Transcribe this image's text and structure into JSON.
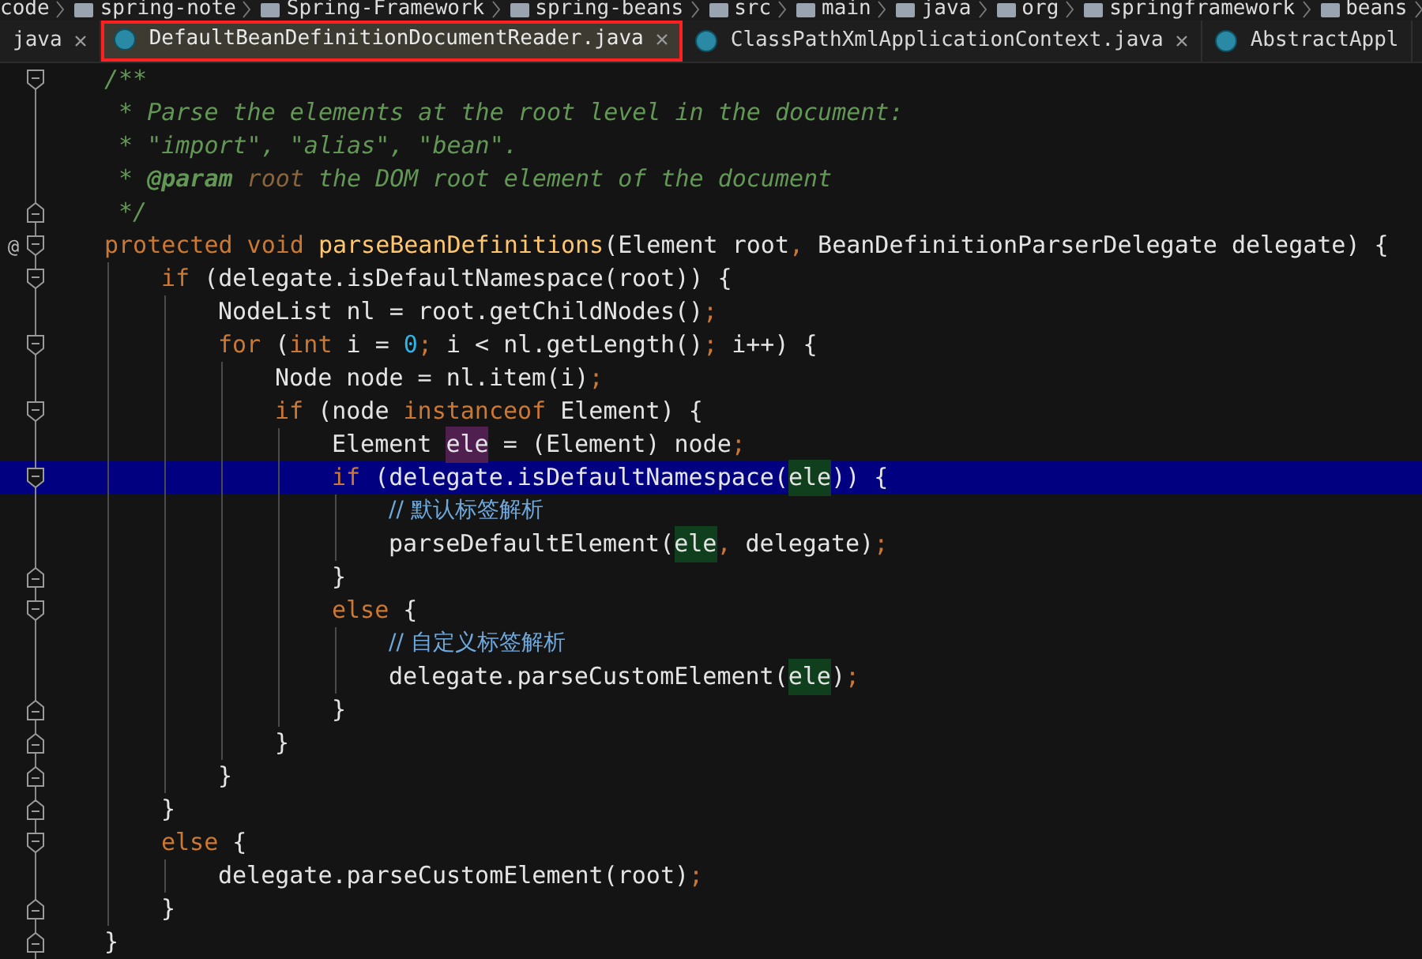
{
  "breadcrumbs": [
    "code",
    "spring-note",
    "Spring-Framework",
    "spring-beans",
    "src",
    "main",
    "java",
    "org",
    "springframework",
    "beans"
  ],
  "tabs": [
    {
      "label": "java",
      "selected": false,
      "closable": true,
      "icon": false,
      "marked": false
    },
    {
      "label": "DefaultBeanDefinitionDocumentReader.java",
      "selected": true,
      "closable": true,
      "icon": true,
      "marked": true
    },
    {
      "label": "ClassPathXmlApplicationContext.java",
      "selected": false,
      "closable": true,
      "icon": true,
      "marked": false
    },
    {
      "label": "AbstractAppl",
      "selected": false,
      "closable": false,
      "icon": true,
      "marked": false
    }
  ],
  "editor": {
    "lines": [
      {
        "fold_open": true,
        "selected": false,
        "tokens": [
          {
            "kind": "doc",
            "text": "/**"
          }
        ]
      },
      {
        "selected": false,
        "tokens": [
          {
            "kind": "doc",
            "text": " * Parse the elements at the root level in the document:"
          }
        ]
      },
      {
        "selected": false,
        "tokens": [
          {
            "kind": "doc",
            "text": " * \"import\", \"alias\", \"bean\"."
          }
        ]
      },
      {
        "selected": false,
        "tokens": [
          {
            "kind": "doc",
            "text": " * "
          },
          {
            "kind": "doctag",
            "text": "@param"
          },
          {
            "kind": "docparam",
            "text": " root"
          },
          {
            "kind": "doc",
            "text": " the DOM root element of the document"
          }
        ]
      },
      {
        "fold_close": true,
        "selected": false,
        "tokens": [
          {
            "kind": "doc",
            "text": " */"
          }
        ]
      },
      {
        "fold_open": true,
        "marker": "@",
        "selected": false,
        "tokens": [
          {
            "kind": "keyword",
            "text": "protected void "
          },
          {
            "kind": "method",
            "text": "parseBeanDefinitions"
          },
          {
            "kind": "plain",
            "text": "(Element root"
          },
          {
            "kind": "punct",
            "text": ","
          },
          {
            "kind": "plain",
            "text": " BeanDefinitionParserDelegate delegate) {"
          }
        ],
        "children": [
          {
            "fold_open": true,
            "selected": false,
            "tokens": [
              {
                "kind": "keyword",
                "text": "if "
              },
              {
                "kind": "plain",
                "text": "(delegate.isDefaultNamespace(root)) {"
              }
            ],
            "children": [
              {
                "selected": false,
                "tokens": [
                  {
                    "kind": "plain",
                    "text": "NodeList nl = root.getChildNodes()"
                  },
                  {
                    "kind": "punct",
                    "text": ";"
                  }
                ]
              },
              {
                "fold_open": true,
                "selected": false,
                "tokens": [
                  {
                    "kind": "keyword",
                    "text": "for "
                  },
                  {
                    "kind": "plain",
                    "text": "("
                  },
                  {
                    "kind": "keyword",
                    "text": "int "
                  },
                  {
                    "kind": "plain",
                    "text": "i = "
                  },
                  {
                    "kind": "number",
                    "text": "0"
                  },
                  {
                    "kind": "punct",
                    "text": ";"
                  },
                  {
                    "kind": "plain",
                    "text": " i < nl.getLength()"
                  },
                  {
                    "kind": "punct",
                    "text": ";"
                  },
                  {
                    "kind": "plain",
                    "text": " i++) {"
                  }
                ],
                "children": [
                  {
                    "selected": false,
                    "tokens": [
                      {
                        "kind": "plain",
                        "text": "Node node = nl.item(i)"
                      },
                      {
                        "kind": "punct",
                        "text": ";"
                      }
                    ]
                  },
                  {
                    "fold_open": true,
                    "selected": false,
                    "tokens": [
                      {
                        "kind": "keyword",
                        "text": "if "
                      },
                      {
                        "kind": "plain",
                        "text": "(node "
                      },
                      {
                        "kind": "keyword",
                        "text": "instanceof "
                      },
                      {
                        "kind": "plain",
                        "text": "Element) {"
                      }
                    ],
                    "children": [
                      {
                        "selected": false,
                        "tokens": [
                          {
                            "kind": "plain",
                            "text": "Element "
                          },
                          {
                            "kind": "declared",
                            "text": "ele"
                          },
                          {
                            "kind": "plain",
                            "text": " = (Element) node"
                          },
                          {
                            "kind": "punct",
                            "text": ";"
                          }
                        ]
                      },
                      {
                        "fold_open": true,
                        "selected": true,
                        "tokens": [
                          {
                            "kind": "keyword",
                            "text": "if "
                          },
                          {
                            "kind": "plain",
                            "text": "(delegate.isDefaultNamespace("
                          },
                          {
                            "kind": "usage",
                            "text": "ele"
                          },
                          {
                            "kind": "plain",
                            "text": ")) {"
                          }
                        ],
                        "children": [
                          {
                            "selected": false,
                            "tokens": [
                              {
                                "kind": "comment",
                                "text": "// 默认标签解析"
                              }
                            ]
                          },
                          {
                            "selected": false,
                            "tokens": [
                              {
                                "kind": "plain",
                                "text": "parseDefaultElement("
                              },
                              {
                                "kind": "usage",
                                "text": "ele"
                              },
                              {
                                "kind": "punct",
                                "text": ","
                              },
                              {
                                "kind": "plain",
                                "text": " delegate)"
                              },
                              {
                                "kind": "punct",
                                "text": ";"
                              }
                            ]
                          }
                        ]
                      },
                      {
                        "fold_close": true,
                        "selected": false,
                        "tokens": [
                          {
                            "kind": "plain",
                            "text": "}"
                          }
                        ]
                      },
                      {
                        "fold_open": true,
                        "selected": false,
                        "tokens": [
                          {
                            "kind": "keyword",
                            "text": "else "
                          },
                          {
                            "kind": "plain",
                            "text": "{"
                          }
                        ],
                        "children": [
                          {
                            "selected": false,
                            "tokens": [
                              {
                                "kind": "comment",
                                "text": "// 自定义标签解析"
                              }
                            ]
                          },
                          {
                            "selected": false,
                            "tokens": [
                              {
                                "kind": "plain",
                                "text": "delegate.parseCustomElement("
                              },
                              {
                                "kind": "usage",
                                "text": "ele"
                              },
                              {
                                "kind": "plain",
                                "text": ")"
                              },
                              {
                                "kind": "punct",
                                "text": ";"
                              }
                            ]
                          }
                        ]
                      },
                      {
                        "fold_close": true,
                        "selected": false,
                        "tokens": [
                          {
                            "kind": "plain",
                            "text": "}"
                          }
                        ]
                      }
                    ]
                  },
                  {
                    "fold_close": true,
                    "selected": false,
                    "tokens": [
                      {
                        "kind": "plain",
                        "text": "}"
                      }
                    ]
                  }
                ]
              },
              {
                "fold_close": true,
                "selected": false,
                "tokens": [
                  {
                    "kind": "plain",
                    "text": "}"
                  }
                ]
              }
            ]
          },
          {
            "fold_close": true,
            "selected": false,
            "tokens": [
              {
                "kind": "plain",
                "text": "}"
              }
            ]
          },
          {
            "fold_open": true,
            "selected": false,
            "tokens": [
              {
                "kind": "keyword",
                "text": "else "
              },
              {
                "kind": "plain",
                "text": "{"
              }
            ],
            "children": [
              {
                "selected": false,
                "tokens": [
                  {
                    "kind": "plain",
                    "text": "delegate.parseCustomElement(root)"
                  },
                  {
                    "kind": "punct",
                    "text": ";"
                  }
                ]
              }
            ]
          },
          {
            "fold_close": true,
            "selected": false,
            "tokens": [
              {
                "kind": "plain",
                "text": "}"
              }
            ]
          }
        ]
      },
      {
        "fold_close": true,
        "selected": false,
        "tokens": [
          {
            "kind": "plain",
            "text": "}"
          }
        ]
      }
    ]
  }
}
